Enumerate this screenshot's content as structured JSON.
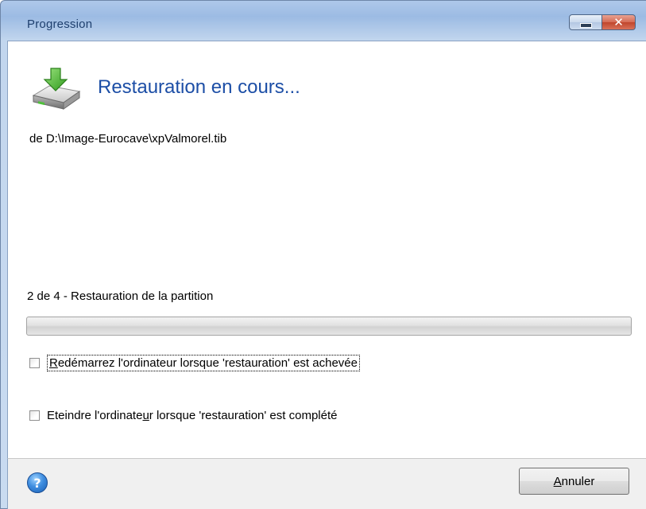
{
  "window": {
    "title": "Progression",
    "minimize_label": "minimize",
    "close_glyph": "✕"
  },
  "header": {
    "title": "Restauration en cours...",
    "icon": "disk-restore-icon"
  },
  "source_text": "de D:\\Image-Eurocave\\xpValmorel.tib",
  "step_text": "2 de 4 - Restauration de la partition",
  "progress": {
    "value_percent": 0
  },
  "options": {
    "restart": {
      "checked": false,
      "text_before": "",
      "accel": "R",
      "text_after": "edémarrez l'ordinateur lorsque 'restauration' est achevée"
    },
    "shutdown": {
      "checked": false,
      "text_before": "Eteindre l'ordinate",
      "accel": "u",
      "text_after": "r lorsque 'restauration' est complété"
    }
  },
  "footer": {
    "help_glyph": "?",
    "cancel": {
      "accel": "A",
      "rest": "nnuler"
    }
  }
}
